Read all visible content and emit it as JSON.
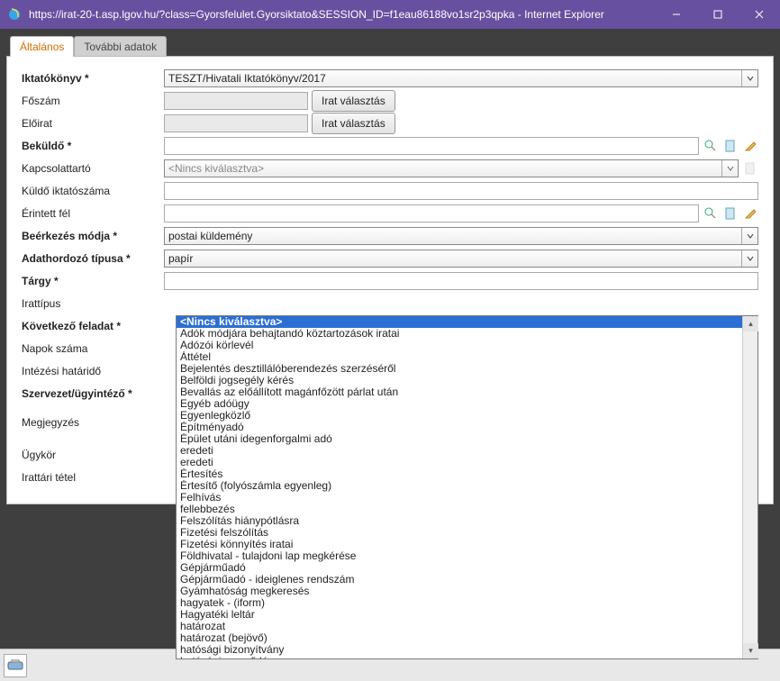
{
  "window": {
    "title": "https://irat-20-t.asp.lgov.hu/?class=Gyorsfelulet.Gyorsiktato&SESSION_ID=f1eau86188vo1sr2p3qpka - Internet Explorer"
  },
  "tabs": {
    "active": "Általános",
    "inactive": "További adatok"
  },
  "form": {
    "iktatokonyv": {
      "label": "Iktatókönyv *",
      "value": "TESZT/Hivatali Iktatókönyv/2017"
    },
    "foszam": {
      "label": "Főszám",
      "value": "",
      "btn": "Irat választás"
    },
    "eloirat": {
      "label": "Előirat",
      "value": "",
      "btn": "Irat választás"
    },
    "bekuldo": {
      "label": "Beküldő *",
      "value": ""
    },
    "kapcsolattarto": {
      "label": "Kapcsolattartó",
      "placeholder": "<Nincs kiválasztva>"
    },
    "kuldo_iktatoszama": {
      "label": "Küldő iktatószáma",
      "value": ""
    },
    "erintett_fel": {
      "label": "Érintett fél",
      "value": ""
    },
    "beerkezes_modja": {
      "label": "Beérkezés módja *",
      "value": "postai küldemény"
    },
    "adathordozo_tipusa": {
      "label": "Adathordozó típusa *",
      "value": "papír"
    },
    "targy": {
      "label": "Tárgy *",
      "value": ""
    },
    "irattipus": {
      "label": "Irattípus"
    },
    "kovetkezo_feladat": {
      "label": "Következő feladat *"
    },
    "napok_szama": {
      "label": "Napok száma"
    },
    "intezesi_hatarido": {
      "label": "Intézési határidő"
    },
    "szervezet_ugyintezo": {
      "label": "Szervezet/ügyintéző *"
    },
    "megjegyzes": {
      "label": "Megjegyzés"
    },
    "ugykor": {
      "label": "Ügykör"
    },
    "irattari_tetel": {
      "label": "Irattári tétel"
    }
  },
  "dropdown": {
    "options": [
      "<Nincs kiválasztva>",
      "Adók módjára behajtandó köztartozások iratai",
      "Adózói körlevél",
      "Áttétel",
      "Bejelentés desztillálóberendezés szerzéséről",
      "Belföldi jogsegély kérés",
      "Bevallás az előállított magánfőzött párlat után",
      "Egyéb adóügy",
      "Egyenlegközlő",
      "Építményadó",
      "Épület utáni idegenforgalmi adó",
      "eredeti",
      "eredeti",
      "Értesítés",
      "Értesítő (folyószámla egyenleg)",
      "Felhívás",
      "fellebbezés",
      "Felszólítás hiánypótlásra",
      "Fizetési felszólítás",
      "Fizetési könnyítés iratai",
      "Földhivatal - tulajdoni lap megkérése",
      "Gépjárműadó",
      "Gépjárműadó - ideiglenes rendszám",
      "Gyámhatóság megkeresés",
      "hagyatek - (iform)",
      "Hagyatéki leltár",
      "határozat",
      "határozat (bejövő)",
      "hatósági bizonyítvány",
      "hatósági szerződés"
    ]
  }
}
